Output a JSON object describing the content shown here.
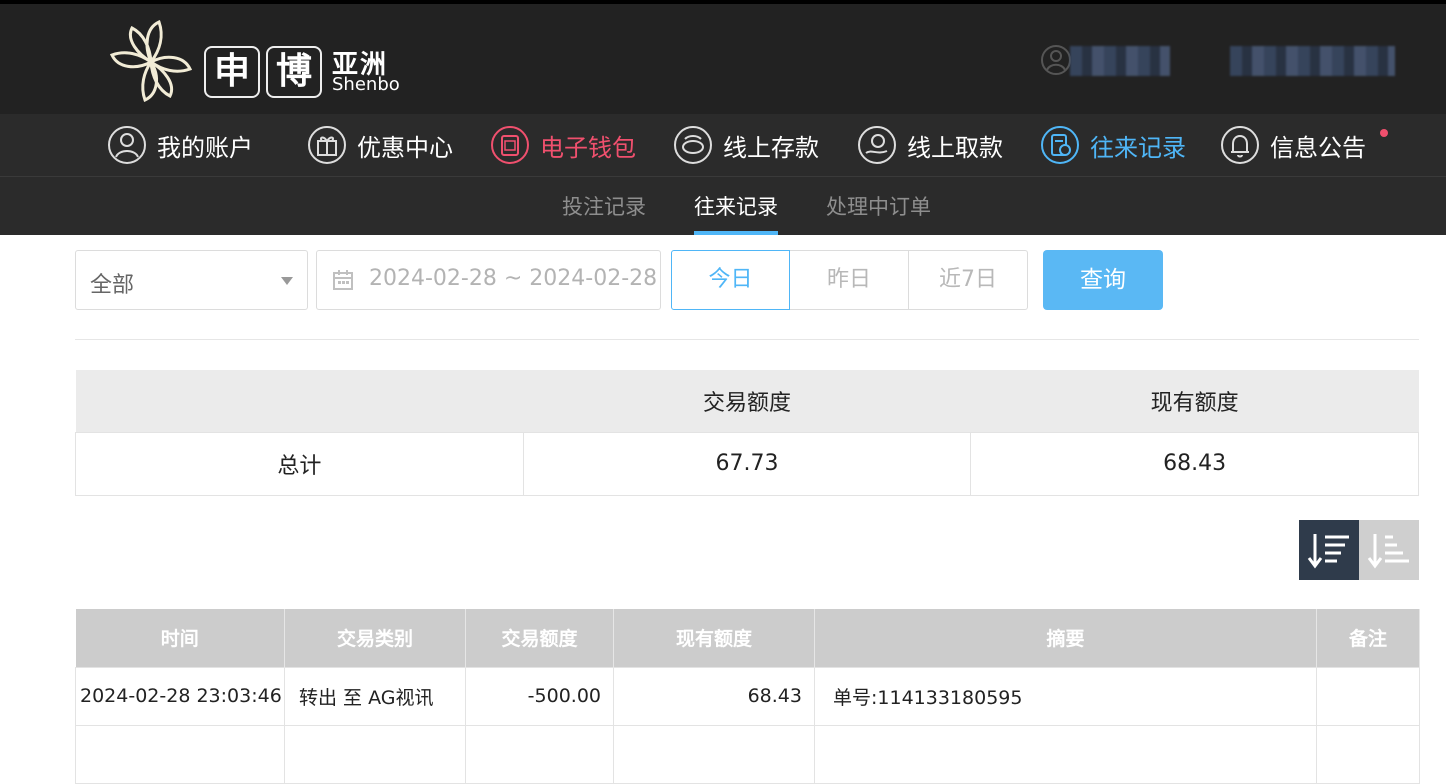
{
  "logo": {
    "char1": "申",
    "char2": "博",
    "cn": "亚洲",
    "en": "Shenbo"
  },
  "nav": {
    "items": [
      {
        "label": "我的账户",
        "icon": "user-circle-icon"
      },
      {
        "label": "优惠中心",
        "icon": "gift-icon"
      },
      {
        "label": "电子钱包",
        "icon": "wallet-icon"
      },
      {
        "label": "线上存款",
        "icon": "deposit-icon"
      },
      {
        "label": "线上取款",
        "icon": "withdraw-icon"
      },
      {
        "label": "往来记录",
        "icon": "records-icon"
      },
      {
        "label": "信息公告",
        "icon": "bell-icon"
      }
    ],
    "active": "往来记录",
    "accent": "#4fb6f7",
    "wallet_color": "#f0506e"
  },
  "subnav": {
    "items": [
      "投注记录",
      "往来记录",
      "处理中订单"
    ],
    "active": "往来记录"
  },
  "filter": {
    "type_value": "全部",
    "date_range": "2024-02-28 ~ 2024-02-28",
    "quick": [
      "今日",
      "昨日",
      "近7日"
    ],
    "quick_active": "今日",
    "query_label": "查询"
  },
  "summary": {
    "headers": [
      "",
      "交易额度",
      "现有额度"
    ],
    "row": [
      "总计",
      "67.73",
      "68.43"
    ]
  },
  "sort": {
    "desc_icon": "sort-desc-icon",
    "asc_icon": "sort-asc-icon"
  },
  "detail": {
    "headers": [
      "时间",
      "交易类别",
      "交易额度",
      "现有额度",
      "摘要",
      "备注"
    ],
    "rows": [
      [
        "2024-02-28 23:03:46",
        "转出 至 AG视讯",
        "-500.00",
        "68.43",
        "单号:114133180595",
        ""
      ]
    ]
  }
}
